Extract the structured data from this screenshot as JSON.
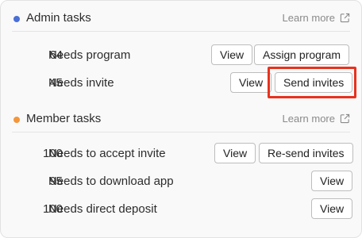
{
  "admin": {
    "title": "Admin tasks",
    "dot_color": "#4a6fd6",
    "learn_more": "Learn more",
    "learn_icon": "external-link-icon",
    "rows": [
      {
        "count": "64",
        "label": "Needs program",
        "buttons": [
          "View",
          "Assign program"
        ]
      },
      {
        "count": "45",
        "label": "Needs invite",
        "buttons": [
          "View",
          "Send invites"
        ]
      }
    ]
  },
  "member": {
    "title": "Member tasks",
    "dot_color": "#f5963a",
    "learn_more": "Learn more",
    "learn_icon": "external-link-icon",
    "rows": [
      {
        "count": "100",
        "label": "Needs to accept invite",
        "buttons": [
          "View",
          "Re-send invites"
        ]
      },
      {
        "count": "95",
        "label": "Needs to download app",
        "buttons": [
          "View"
        ]
      },
      {
        "count": "100",
        "label": "Needs direct deposit",
        "buttons": [
          "View"
        ]
      }
    ]
  },
  "highlight_color": "#e8321e"
}
